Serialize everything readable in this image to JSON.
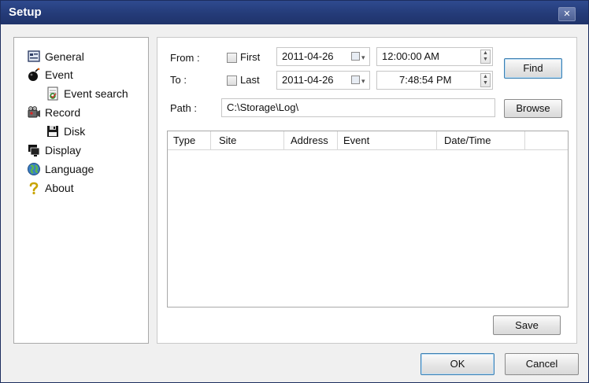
{
  "window": {
    "title": "Setup",
    "close_glyph": "✕"
  },
  "nav": {
    "items": [
      {
        "label": "General",
        "icon": "general-settings-icon"
      },
      {
        "label": "Event",
        "icon": "event-bomb-icon"
      },
      {
        "label": "Event search",
        "icon": "event-search-icon"
      },
      {
        "label": "Record",
        "icon": "record-icon"
      },
      {
        "label": "Disk",
        "icon": "disk-icon"
      },
      {
        "label": "Display",
        "icon": "display-icon"
      },
      {
        "label": "Language",
        "icon": "globe-icon"
      },
      {
        "label": "About",
        "icon": "question-icon"
      }
    ]
  },
  "filter": {
    "from_label": "From :",
    "to_label": "To :",
    "first_label": "First",
    "last_label": "Last",
    "first_checked": false,
    "last_checked": false,
    "from_date": "2011-04-26",
    "from_time": "12:00:00 AM",
    "to_date": "2011-04-26",
    "to_time": "7:48:54 PM",
    "path_label": "Path :",
    "path_value": "C:\\Storage\\Log\\"
  },
  "buttons": {
    "find": "Find",
    "browse": "Browse",
    "save": "Save",
    "ok": "OK",
    "cancel": "Cancel"
  },
  "table": {
    "columns": [
      "Type",
      "Site",
      "Address",
      "Event",
      "Date/Time"
    ],
    "rows": []
  },
  "colors": {
    "titlebar": "#243b78",
    "default_button_border": "#3c7fb1"
  }
}
